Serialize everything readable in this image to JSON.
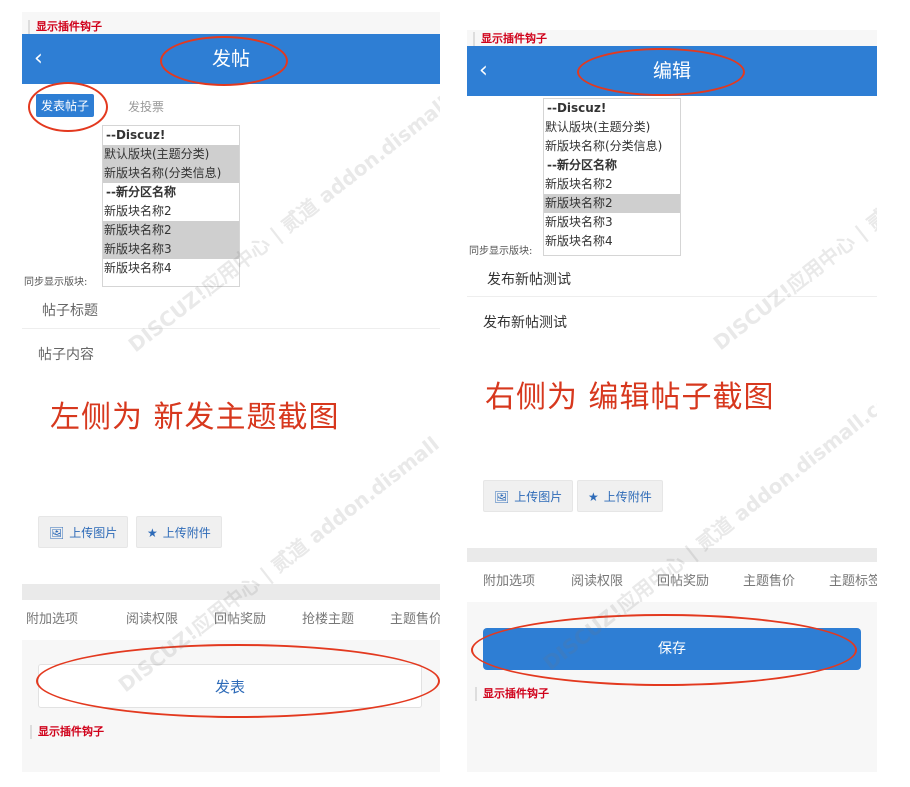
{
  "watermark": "DISCUZ!应用中心 | 贰道 addon.dismall.com",
  "left": {
    "plugin_hook_top": "显示插件钩子",
    "back_icon": "‹",
    "title": "发帖",
    "tabs": {
      "active": "发表帖子",
      "other": "发投票"
    },
    "forum_options": [
      {
        "label": "--Discuz!",
        "group": true,
        "highlight": false
      },
      {
        "label": "默认版块(主题分类)",
        "group": false,
        "highlight": true
      },
      {
        "label": "新版块名称(分类信息)",
        "group": false,
        "highlight": true
      },
      {
        "label": "--新分区名称",
        "group": true,
        "highlight": false
      },
      {
        "label": "新版块名称2",
        "group": false,
        "highlight": false
      },
      {
        "label": "新版块名称2",
        "group": false,
        "highlight": true
      },
      {
        "label": "新版块名称3",
        "group": false,
        "highlight": true
      },
      {
        "label": "新版块名称4",
        "group": false,
        "highlight": false
      }
    ],
    "sync_label": "同步显示版块:",
    "subject_placeholder": "帖子标题",
    "content_placeholder": "帖子内容",
    "caption": "左侧为 新发主题截图",
    "upload_image": "上传图片",
    "upload_attach": "上传附件",
    "option_tabs": [
      "附加选项",
      "阅读权限",
      "回帖奖励",
      "抢楼主题",
      "主题售价"
    ],
    "submit": "发表",
    "plugin_hook_bottom": "显示插件钩子"
  },
  "right": {
    "plugin_hook_top": "显示插件钩子",
    "back_icon": "‹",
    "title": "编辑",
    "forum_options": [
      {
        "label": "--Discuz!",
        "group": true,
        "highlight": false
      },
      {
        "label": "默认版块(主题分类)",
        "group": false,
        "highlight": false
      },
      {
        "label": "新版块名称(分类信息)",
        "group": false,
        "highlight": false
      },
      {
        "label": "--新分区名称",
        "group": true,
        "highlight": false
      },
      {
        "label": "新版块名称2",
        "group": false,
        "highlight": false
      },
      {
        "label": "新版块名称2",
        "group": false,
        "highlight": true
      },
      {
        "label": "新版块名称3",
        "group": false,
        "highlight": false
      },
      {
        "label": "新版块名称4",
        "group": false,
        "highlight": false
      }
    ],
    "sync_label": "同步显示版块:",
    "subject_value": "发布新帖测试",
    "content_value": "发布新帖测试",
    "caption": "右侧为 编辑帖子截图",
    "upload_image": "上传图片",
    "upload_attach": "上传附件",
    "option_tabs": [
      "附加选项",
      "阅读权限",
      "回帖奖励",
      "主题售价",
      "主题标签"
    ],
    "submit": "保存",
    "plugin_hook_bottom": "显示插件钩子"
  },
  "colors": {
    "primary": "#2e7ed4",
    "annotation_red": "#e3391f",
    "hook_red": "#d0021b"
  }
}
